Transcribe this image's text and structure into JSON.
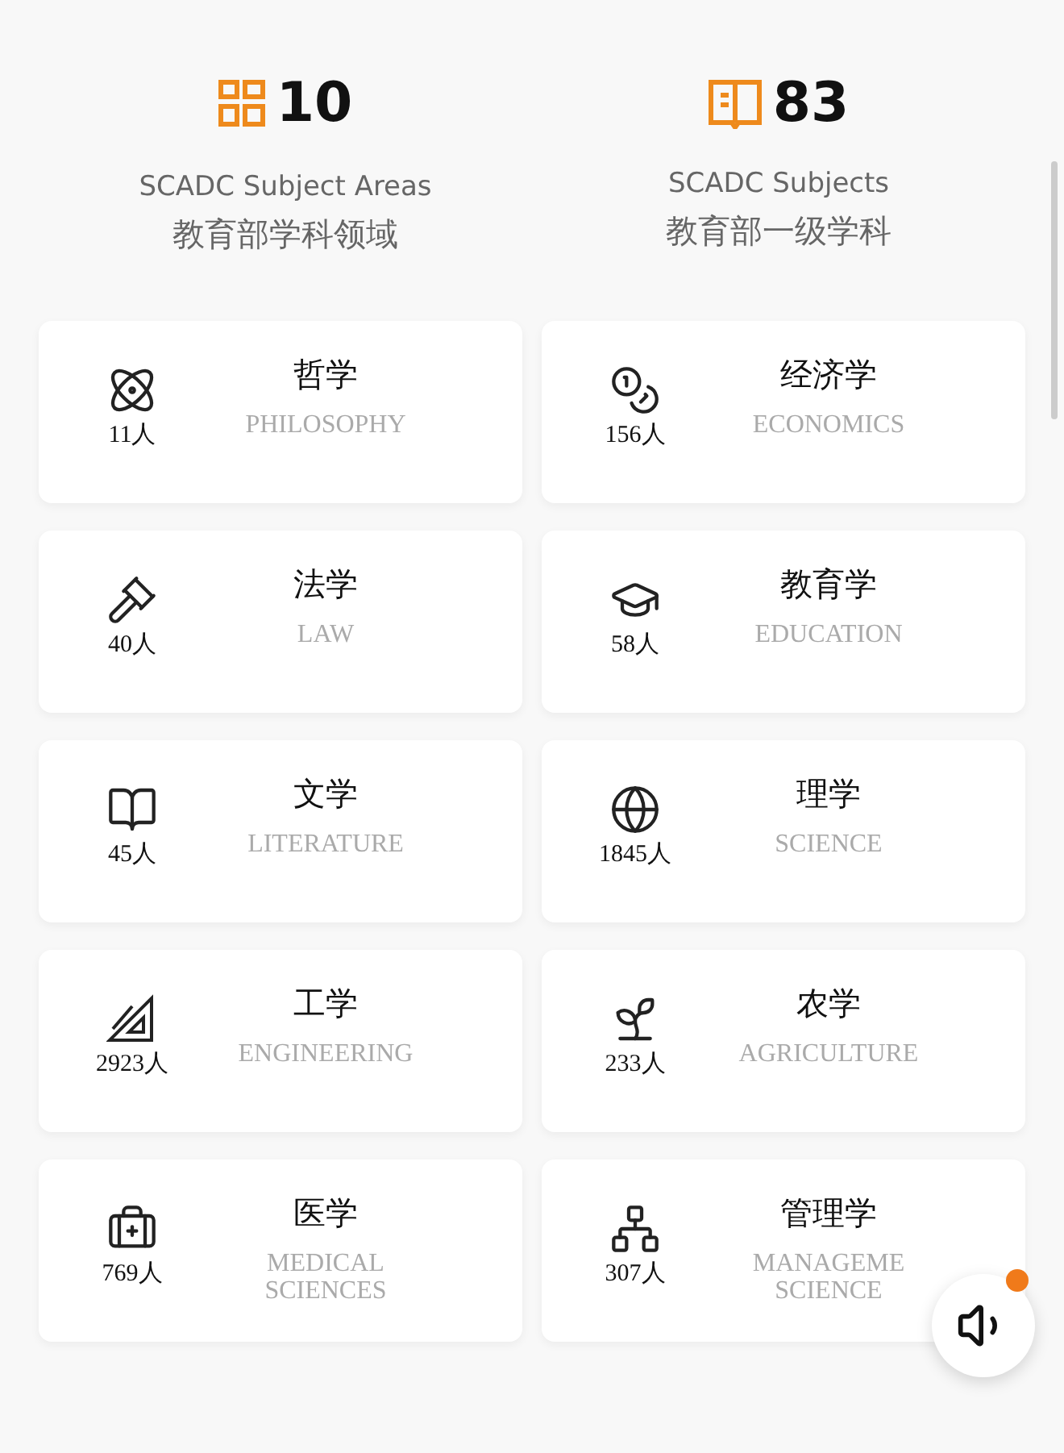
{
  "stats": [
    {
      "kind": "areas",
      "number": "10",
      "en": "SCADC Subject Areas",
      "zh": "教育部学科领域"
    },
    {
      "kind": "subjects",
      "number": "83",
      "en": "SCADC Subjects",
      "zh": "教育部一级学科"
    }
  ],
  "cards": [
    {
      "kind": "atom",
      "count": "11人",
      "zh": "哲学",
      "en_lines": [
        "PHILOSOPHY"
      ]
    },
    {
      "kind": "coins",
      "count": "156人",
      "zh": "经济学",
      "en_lines": [
        "ECONOMICS"
      ]
    },
    {
      "kind": "gavel",
      "count": "40人",
      "zh": "法学",
      "en_lines": [
        "LAW"
      ]
    },
    {
      "kind": "cap",
      "count": "58人",
      "zh": "教育学",
      "en_lines": [
        "EDUCATION"
      ]
    },
    {
      "kind": "book",
      "count": "45人",
      "zh": "文学",
      "en_lines": [
        "LITERATURE"
      ]
    },
    {
      "kind": "globe",
      "count": "1845人",
      "zh": "理学",
      "en_lines": [
        "SCIENCE"
      ]
    },
    {
      "kind": "ruler",
      "count": "2923人",
      "zh": "工学",
      "en_lines": [
        "ENGINEERING"
      ]
    },
    {
      "kind": "sprout",
      "count": "233人",
      "zh": "农学",
      "en_lines": [
        "AGRICULTURE"
      ]
    },
    {
      "kind": "medkit",
      "count": "769人",
      "zh": "医学",
      "en_lines": [
        "MEDICAL",
        "SCIENCES"
      ]
    },
    {
      "kind": "hierarchy",
      "count": "307人",
      "zh": "管理学",
      "en_lines": [
        "MANAGEME",
        "SCIENCE"
      ]
    }
  ],
  "sound_button": {
    "notification": true
  }
}
